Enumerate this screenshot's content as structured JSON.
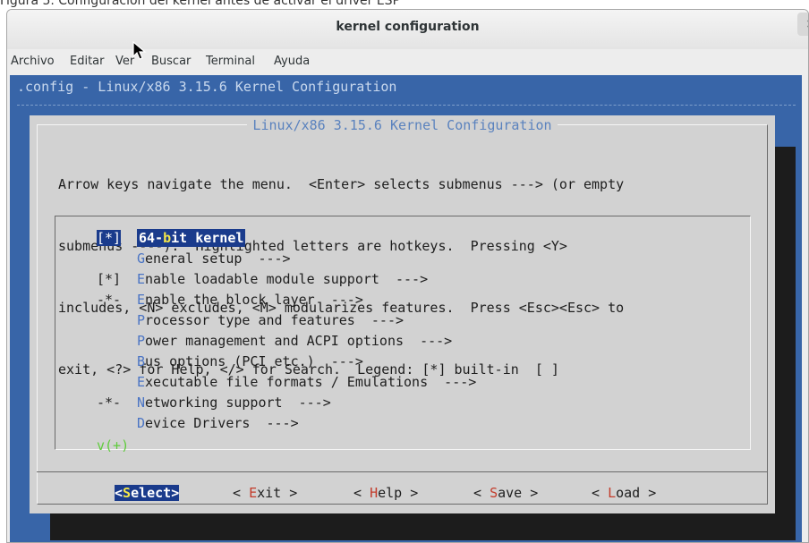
{
  "top_fragment": "Figura 5. Configuración del kernel antes de activar el driver ESP",
  "window": {
    "title": "kernel configuration",
    "close_glyph": "×"
  },
  "menubar": [
    "Archivo",
    "Editar",
    "Ver",
    "Buscar",
    "Terminal",
    "Ayuda"
  ],
  "terminal": {
    "config_title": ".config - Linux/x86 3.15.6 Kernel Configuration",
    "dialog_title": "Linux/x86 3.15.6 Kernel Configuration",
    "help_lines": [
      "Arrow keys navigate the menu.  <Enter> selects submenus ---> (or empty",
      "submenus ----).  Highlighted letters are hotkeys.  Pressing <Y>",
      "includes, <N> excludes, <M> modularizes features.  Press <Esc><Esc> to",
      "exit, <?> for Help, </> for Search.  Legend: [*] built-in  [ ]"
    ],
    "menu_items": [
      {
        "prefix": "[*]",
        "pre": "64-",
        "hotkey": "b",
        "post": "it kernel",
        "selected": true
      },
      {
        "prefix": "",
        "pre": "",
        "hotkey": "G",
        "post": "eneral setup  --->",
        "selected": false
      },
      {
        "prefix": "[*]",
        "pre": "",
        "hotkey": "E",
        "post": "nable loadable module support  --->",
        "selected": false
      },
      {
        "prefix": "-*-",
        "pre": "",
        "hotkey": "E",
        "post": "nable the block layer  --->",
        "selected": false
      },
      {
        "prefix": "",
        "pre": "",
        "hotkey": "P",
        "post": "rocessor type and features  --->",
        "selected": false
      },
      {
        "prefix": "",
        "pre": "",
        "hotkey": "P",
        "post": "ower management and ACPI options  --->",
        "selected": false
      },
      {
        "prefix": "",
        "pre": "",
        "hotkey": "B",
        "post": "us options (PCI etc.)  --->",
        "selected": false
      },
      {
        "prefix": "",
        "pre": "",
        "hotkey": "E",
        "post": "xecutable file formats / Emulations  --->",
        "selected": false
      },
      {
        "prefix": "-*-",
        "pre": "",
        "hotkey": "N",
        "post": "etworking support  --->",
        "selected": false
      },
      {
        "prefix": "",
        "pre": "",
        "hotkey": "D",
        "post": "evice Drivers  --->",
        "selected": false
      }
    ],
    "more_indicator": "v(+)",
    "buttons": [
      {
        "left": "<",
        "hotkey": "S",
        "rest": "elect",
        "right": ">",
        "selected": true
      },
      {
        "left": "< ",
        "hotkey": "E",
        "rest": "xit",
        "right": " >",
        "selected": false
      },
      {
        "left": "< ",
        "hotkey": "H",
        "rest": "elp",
        "right": " >",
        "selected": false
      },
      {
        "left": "< ",
        "hotkey": "S",
        "rest": "ave",
        "right": " >",
        "selected": false
      },
      {
        "left": "< ",
        "hotkey": "L",
        "rest": "oad",
        "right": " >",
        "selected": false
      }
    ]
  },
  "colors": {
    "terminal_bg": "#3865a8",
    "dialog_bg": "#d2d2d2",
    "highlight_bg": "#1a3b8c",
    "hotkey_blue": "#4a74c4",
    "hotkey_red": "#c33b2a",
    "hotkey_yellow": "#f3e64a",
    "more_green": "#5fcc3c"
  }
}
